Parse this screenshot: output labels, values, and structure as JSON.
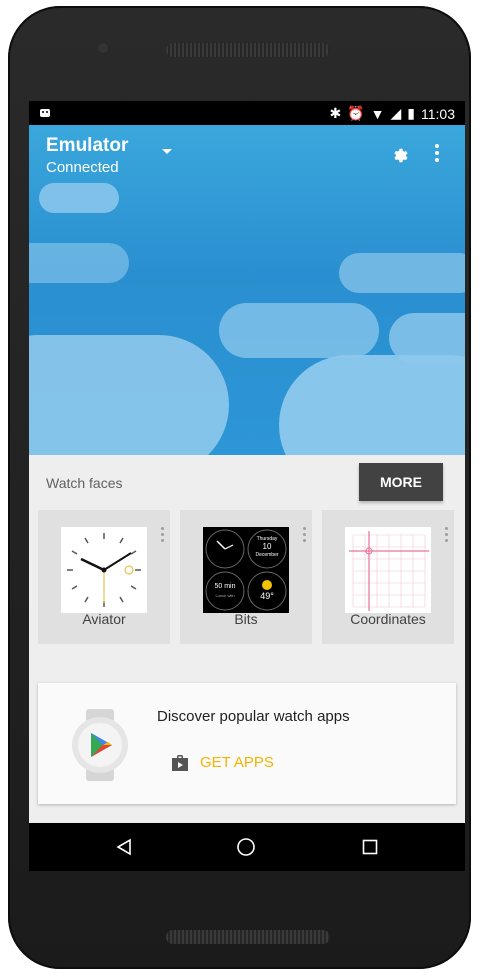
{
  "status_bar": {
    "time": "11:03",
    "notification_icon": "android-icon",
    "icons": [
      "bluetooth-icon",
      "alarm-icon",
      "wifi-icon",
      "signal-icon",
      "battery-icon"
    ]
  },
  "header": {
    "device_name": "Emulator",
    "device_status": "Connected",
    "dropdown_icon": "caret-down-icon",
    "settings_icon": "gear-icon",
    "overflow_icon": "more-vert-icon"
  },
  "watch_faces": {
    "section_title": "Watch faces",
    "more_label": "MORE",
    "items": [
      {
        "label": "Aviator"
      },
      {
        "label": "Bits",
        "widgets": {
          "day": "Thursday",
          "date": "10",
          "month": "December",
          "timer": "50 min",
          "timer_caption": "Lunch with",
          "temperature": "49°"
        }
      },
      {
        "label": "Coordinates"
      }
    ]
  },
  "promo": {
    "title": "Discover popular watch apps",
    "action_label": "GET APPS",
    "accent_color": "#f4b400"
  },
  "colors": {
    "hero_blue": "#2a8fd0",
    "more_button": "#424242",
    "card_bg": "#e0e0e0"
  }
}
